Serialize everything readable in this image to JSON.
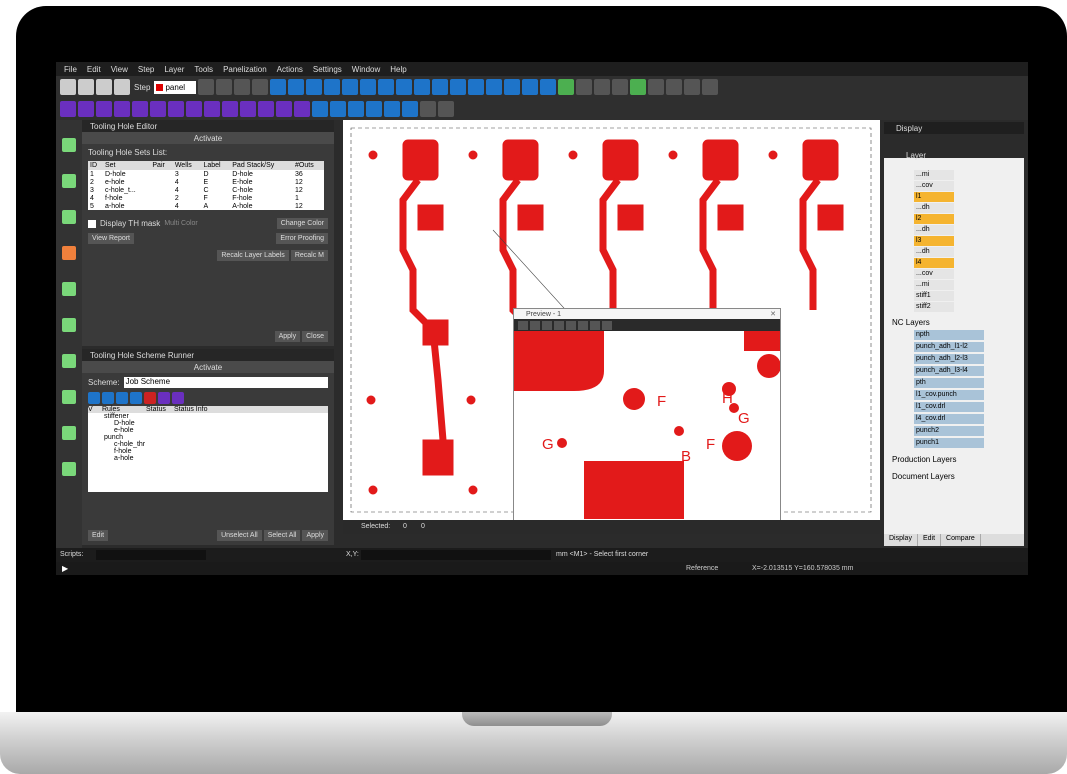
{
  "menu": [
    "File",
    "Edit",
    "View",
    "Step",
    "Layer",
    "Tools",
    "Panelization",
    "Actions",
    "Settings",
    "Window",
    "Help"
  ],
  "toolbar": {
    "step_label": "Step",
    "step_value": "panel"
  },
  "tooling_editor": {
    "title": "Tooling Hole Editor",
    "activate": "Activate",
    "sets_label": "Tooling Hole Sets List:",
    "columns": [
      "ID",
      "Set",
      "Pair",
      "Wells",
      "Label",
      "Pad Stack/Sy",
      "#Outs"
    ],
    "rows": [
      [
        "1",
        "D-hole",
        "3",
        "D",
        "D-hole",
        "36"
      ],
      [
        "2",
        "e-hole",
        "4",
        "E",
        "E-hole",
        "12"
      ],
      [
        "3",
        "c-hole_t...",
        "4",
        "C",
        "C-hole",
        "12"
      ],
      [
        "4",
        "f-hole",
        "2",
        "F",
        "F-hole",
        "1"
      ],
      [
        "5",
        "a-hole",
        "4",
        "A",
        "A-hole",
        "12"
      ]
    ],
    "display_th_mask": "Display TH mask",
    "multi_color": "Multi Color",
    "change_color": "Change Color",
    "view_report": "View Report",
    "error_proofing": "Error Proofing",
    "recalc_labels": "Recalc Layer Labels",
    "recalc_m": "Recalc M",
    "apply": "Apply",
    "close": "Close"
  },
  "scheme_runner": {
    "title": "Tooling Hole Scheme Runner",
    "activate": "Activate",
    "scheme_label": "Scheme:",
    "scheme_value": "Job Scheme",
    "columns": [
      "V",
      "Rules",
      "Status",
      "Status Info"
    ],
    "tree": [
      "stiffener",
      "D-hole",
      "e-hole",
      "punch",
      "c-hole_thr",
      "f-hole",
      "a-hole"
    ],
    "edit": "Edit",
    "unselect_all": "Unselect All",
    "select_all": "Select All",
    "apply": "Apply"
  },
  "preview": {
    "title": "Preview - 1",
    "labels": [
      "F",
      "H",
      "G",
      "G",
      "F",
      "B"
    ]
  },
  "display_panel": {
    "title": "Display",
    "layer_header": "Layer",
    "layers": [
      "...mi",
      "...cov",
      "l1",
      "...dh",
      "l2",
      "...dh",
      "l3",
      "...dh",
      "l4",
      "...cov",
      "...mi",
      "stiff1",
      "stiff2"
    ],
    "nc_title": "NC Layers",
    "nc_layers": [
      "npth",
      "punch_adh_l1-l2",
      "punch_adh_l2-l3",
      "punch_adh_l3-l4",
      "pth",
      "l1_cov.punch",
      "l1_cov.drl",
      "l4_cov.drl",
      "punch2",
      "punch1"
    ],
    "production": "Production Layers",
    "document": "Document Layers",
    "tabs": [
      "Display",
      "Edit",
      "Compare"
    ]
  },
  "statusbar": {
    "scripts": "Scripts:",
    "selected": "Selected:",
    "selected_count": "0",
    "sel2": "0",
    "xy_label": "X,Y:",
    "hint": "mm <M1> - Select first corner",
    "reference": "Reference",
    "coords": "X=-2.013515 Y=160.578035 mm"
  },
  "colors": {
    "copper": "#e21a1a",
    "accent_blue": "#1e74c9",
    "accent_purple": "#6a2fbf"
  }
}
